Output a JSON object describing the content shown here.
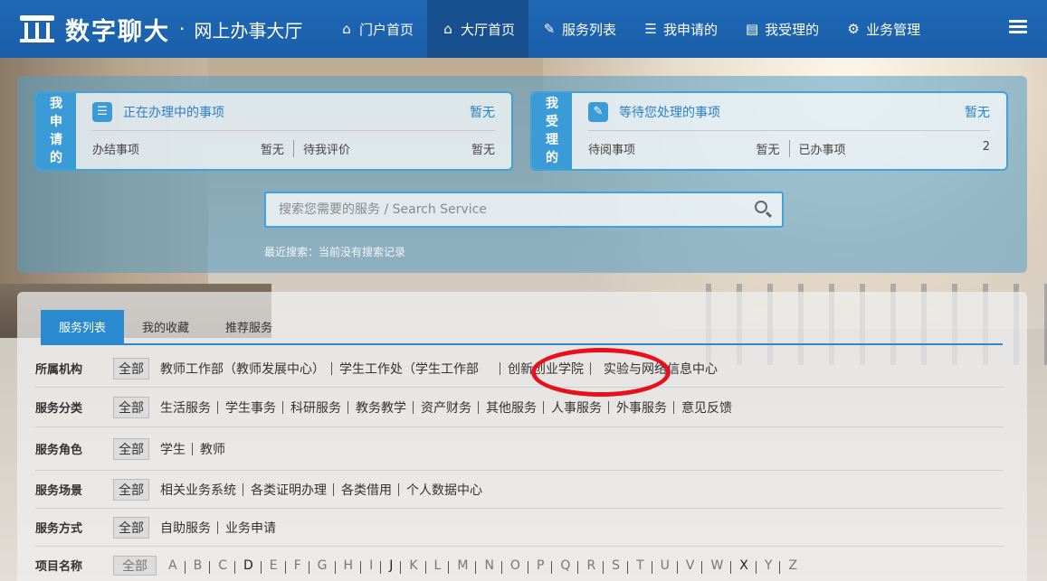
{
  "header": {
    "logo_name": "数字聊大",
    "logo_dot": "·",
    "logo_sub": "网上办事大厅",
    "nav": [
      {
        "label": "门户首页",
        "icon": "home-icon"
      },
      {
        "label": "大厅首页",
        "icon": "home-icon"
      },
      {
        "label": "服务列表",
        "icon": "edit-icon"
      },
      {
        "label": "我申请的",
        "icon": "list-icon"
      },
      {
        "label": "我受理的",
        "icon": "server-icon"
      },
      {
        "label": "业务管理",
        "icon": "settings-icon"
      }
    ],
    "active_nav": "大厅首页"
  },
  "my_applied": {
    "tag": "我申请的",
    "title": "正在办理中的事项",
    "value": "暂无",
    "row": [
      {
        "label": "办结事项",
        "value": "暂无"
      },
      {
        "label": "待我评价",
        "value": "暂无"
      }
    ]
  },
  "my_handled": {
    "tag": "我受理的",
    "title": "等待您处理的事项",
    "value": "暂无",
    "row": [
      {
        "label": "待阅事项",
        "value": "暂无"
      },
      {
        "label": "已办事项",
        "value": "2"
      }
    ]
  },
  "search": {
    "placeholder": "搜索您需要的服务 / Search Service",
    "recent": "最近搜索：当前没有搜索记录"
  },
  "tabs": [
    "服务列表",
    "我的收藏",
    "推荐服务"
  ],
  "filters": {
    "all_label": "全部",
    "rows": [
      {
        "label": "所属机构",
        "options": [
          "教师工作部（教师发展中心）",
          "学生工作处（学生工作部",
          "创新创业学院",
          "实验与网络信息中心"
        ]
      },
      {
        "label": "服务分类",
        "options": [
          "生活服务",
          "学生事务",
          "科研服务",
          "教务教学",
          "资产财务",
          "其他服务",
          "人事服务",
          "外事服务",
          "意见反馈"
        ]
      },
      {
        "label": "服务角色",
        "options": [
          "学生",
          "教师"
        ]
      },
      {
        "label": "服务场景",
        "options": [
          "相关业务系统",
          "各类证明办理",
          "各类借用",
          "个人数据中心"
        ]
      },
      {
        "label": "服务方式",
        "options": [
          "自助服务",
          "业务申请"
        ]
      },
      {
        "label": "项目名称",
        "options": [
          "A",
          "B",
          "C",
          "D",
          "E",
          "F",
          "G",
          "H",
          "I",
          "J",
          "K",
          "L",
          "M",
          "N",
          "O",
          "P",
          "Q",
          "R",
          "S",
          "T",
          "U",
          "V",
          "W",
          "X",
          "Y",
          "Z"
        ]
      }
    ]
  },
  "highlight_color": "#e8101a",
  "accent": "#2a8ad0"
}
